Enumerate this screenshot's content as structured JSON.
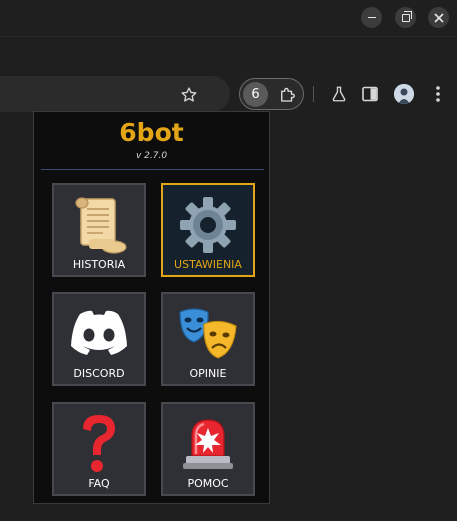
{
  "browser": {
    "extension_badge": "6"
  },
  "popup": {
    "brand": "6bot",
    "version": "v 2.7.0",
    "tiles": [
      {
        "label": "HISTORIA",
        "icon": "scroll-icon",
        "active": false
      },
      {
        "label": "USTAWIENIA",
        "icon": "gear-icon",
        "active": true
      },
      {
        "label": "DISCORD",
        "icon": "discord-icon",
        "active": false
      },
      {
        "label": "OPINIE",
        "icon": "theater-masks-icon",
        "active": false
      },
      {
        "label": "FAQ",
        "icon": "question-mark-icon",
        "active": false
      },
      {
        "label": "POMOC",
        "icon": "siren-icon",
        "active": false
      }
    ]
  },
  "colors": {
    "accent": "#e2a516",
    "tile_bg": "#2e3035",
    "active_tile_bg": "#15212c",
    "discord": "#ffffff"
  }
}
